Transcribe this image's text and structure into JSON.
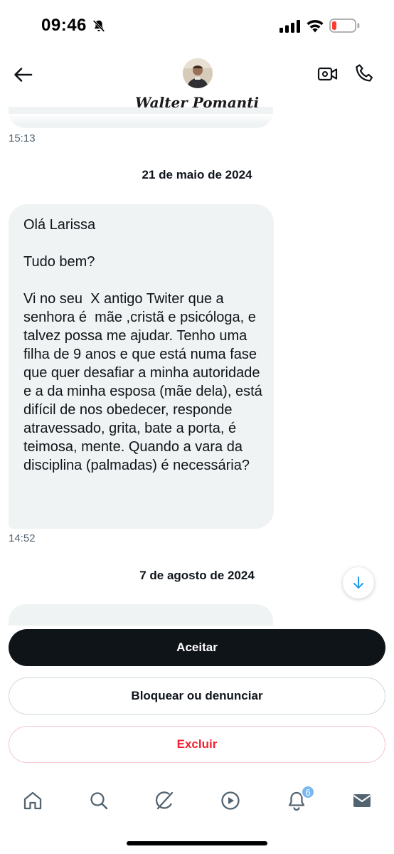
{
  "status_bar": {
    "time": "09:46"
  },
  "header": {
    "contact_name": "Walter Pomanti"
  },
  "messages": [
    {
      "type": "timestamp",
      "text": "15:13"
    },
    {
      "type": "date",
      "text": "21 de maio de 2024"
    },
    {
      "type": "bubble",
      "text": "Olá Larissa\n\nTudo bem?\n\nVi no seu  X antigo Twiter que a senhora é  mãe ,cristã e psicóloga, e talvez possa me ajudar. Tenho uma filha de 9 anos e que está numa fase que quer desafiar a minha autoridade e a da minha esposa (mãe dela), está difícil de nos obedecer, responde atravessado, grita, bate a porta, é teimosa, mente. Quando a vara da disciplina (palmadas) é necessária?"
    },
    {
      "type": "timestamp",
      "text": "14:52"
    },
    {
      "type": "date",
      "text": "7 de agosto de 2024"
    }
  ],
  "actions": {
    "accept": "Aceitar",
    "block_report": "Bloquear ou denunciar",
    "delete": "Excluir"
  },
  "bottom_nav": {
    "items": [
      "home-icon",
      "search-icon",
      "grok-icon",
      "video-play-icon",
      "notifications-icon",
      "messages-icon"
    ],
    "notification_count": "6"
  },
  "colors": {
    "bubble_bg": "#eff3f4",
    "accept_bg": "#0f1419",
    "delete_text": "#f4212e",
    "badge": "#76b8ef",
    "battery_low": "#ff3b30"
  }
}
